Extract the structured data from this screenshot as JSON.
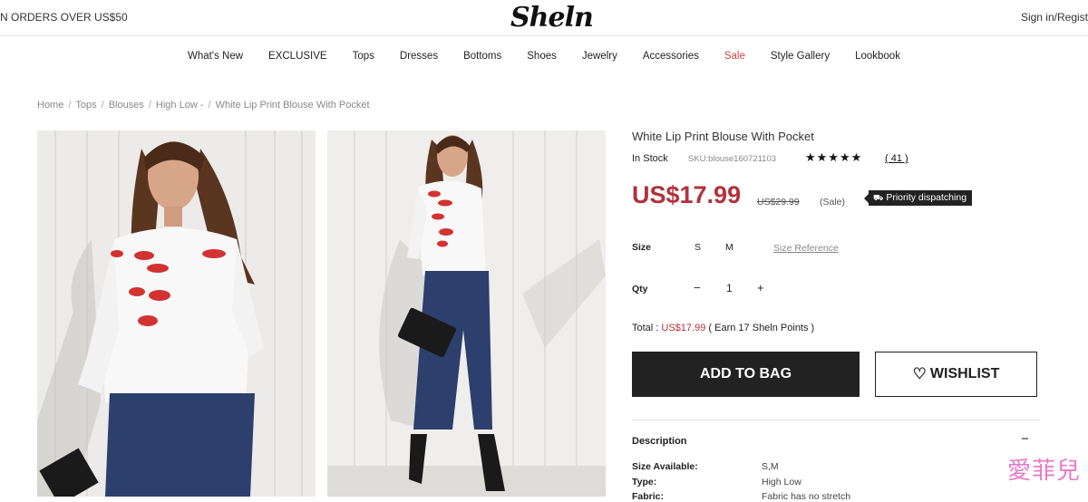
{
  "header": {
    "promo": "N ORDERS OVER US$50",
    "logo": "Sheln",
    "signin": "Sign in/Regist"
  },
  "nav": [
    "What's New",
    "EXCLUSIVE",
    "Tops",
    "Dresses",
    "Bottoms",
    "Shoes",
    "Jewelry",
    "Accessories",
    "Sale",
    "Style Gallery",
    "Lookbook"
  ],
  "breadcrumb": [
    "Home",
    "Tops",
    "Blouses",
    "High Low -",
    "White Lip Print Blouse With Pocket"
  ],
  "product": {
    "title": "White Lip Print Blouse With Pocket",
    "stock": "In Stock",
    "sku": "SKU:blouse160721103",
    "stars": "★★★★★",
    "rating": 5,
    "reviews": "( 41 )",
    "price": "US$17.99",
    "old_price": "US$29.99",
    "sale_tag": "(Sale)",
    "priority": "Priority dispatching",
    "size_label": "Size",
    "sizes": [
      "S",
      "M"
    ],
    "size_reference": "Size Reference",
    "qty_label": "Qty",
    "qty_minus": "−",
    "qty_value": "1",
    "qty_plus": "+",
    "total_prefix": "Total : ",
    "total_price": "US$17.99",
    "total_mid": " ( Earn ",
    "points": "17",
    "total_suffix": " Sheln Points )",
    "add_to_bag": "ADD TO BAG",
    "wishlist": "WISHLIST"
  },
  "description": {
    "heading": "Description",
    "toggle": "−",
    "specs": [
      {
        "k": "Size Available:",
        "v": "S,M"
      },
      {
        "k": "Type:",
        "v": "High Low"
      },
      {
        "k": "Fabric:",
        "v": "Fabric has no stretch"
      }
    ]
  },
  "watermark": "愛菲兒",
  "colors": {
    "price_red": "#b2323b",
    "sale_red": "#cc4444",
    "button_dark": "#222222"
  }
}
